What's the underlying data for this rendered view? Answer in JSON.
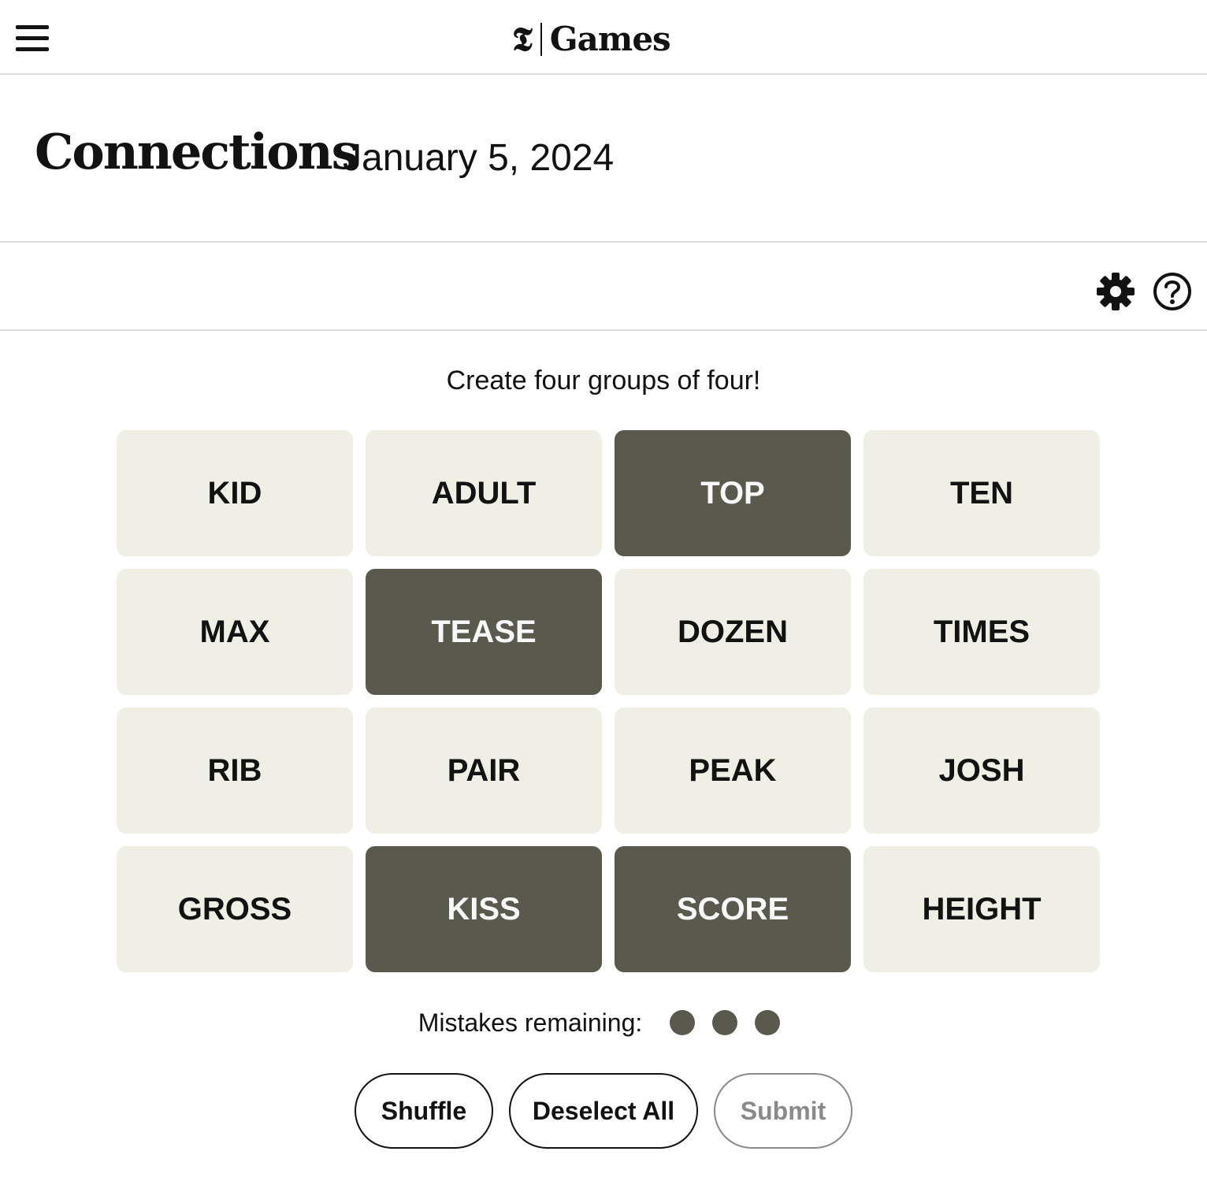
{
  "header": {
    "brand_logo": "𝕿",
    "brand_name": "Games"
  },
  "game": {
    "title": "Connections",
    "date": "January 5, 2024",
    "instructions": "Create four groups of four!"
  },
  "tiles": [
    {
      "word": "KID",
      "selected": false
    },
    {
      "word": "ADULT",
      "selected": false
    },
    {
      "word": "TOP",
      "selected": true
    },
    {
      "word": "TEN",
      "selected": false
    },
    {
      "word": "MAX",
      "selected": false
    },
    {
      "word": "TEASE",
      "selected": true
    },
    {
      "word": "DOZEN",
      "selected": false
    },
    {
      "word": "TIMES",
      "selected": false
    },
    {
      "word": "RIB",
      "selected": false
    },
    {
      "word": "PAIR",
      "selected": false
    },
    {
      "word": "PEAK",
      "selected": false
    },
    {
      "word": "JOSH",
      "selected": false
    },
    {
      "word": "GROSS",
      "selected": false
    },
    {
      "word": "KISS",
      "selected": true
    },
    {
      "word": "SCORE",
      "selected": true
    },
    {
      "word": "HEIGHT",
      "selected": false
    }
  ],
  "mistakes": {
    "label": "Mistakes remaining:",
    "remaining": 3
  },
  "actions": {
    "shuffle_label": "Shuffle",
    "deselect_label": "Deselect All",
    "submit_label": "Submit"
  },
  "colors": {
    "tile_default": "#efefe6",
    "tile_selected": "#5a594e",
    "text_dark": "#121212",
    "disabled": "#8a8a8a"
  },
  "icons": {
    "menu": "hamburger-menu-icon",
    "settings": "gear-icon",
    "help": "help-circle-icon"
  }
}
